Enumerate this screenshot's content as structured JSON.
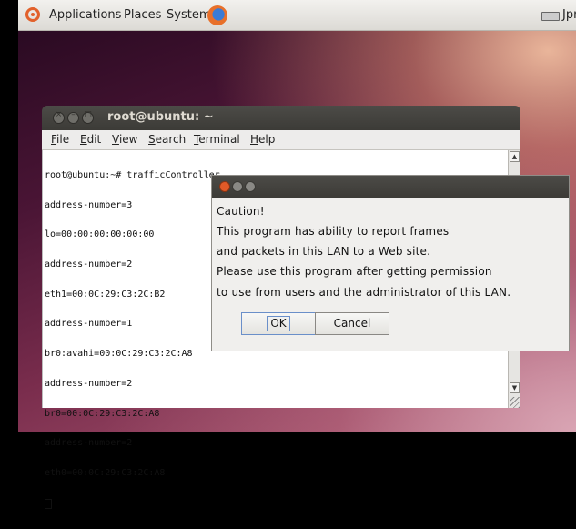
{
  "top_panel": {
    "menus": [
      "Applications",
      "Places",
      "System"
    ],
    "firefox_icon": "firefox-icon",
    "keyboard_icon": "keyboard-icon",
    "keyboard_layout": "Jpn"
  },
  "terminal": {
    "title": "root@ubuntu: ~",
    "menu": {
      "file": {
        "u": "F",
        "rest": "ile"
      },
      "edit": {
        "u": "E",
        "rest": "dit"
      },
      "view": {
        "u": "V",
        "rest": "iew"
      },
      "search": {
        "u": "S",
        "rest": "earch"
      },
      "terminal": {
        "u": "T",
        "rest": "erminal"
      },
      "help": {
        "u": "H",
        "rest": "elp"
      }
    },
    "lines": [
      "root@ubuntu:~# trafficController",
      "address-number=3",
      "lo=00:00:00:00:00:00",
      "address-number=2",
      "eth1=00:0C:29:C3:2C:B2",
      "address-number=1",
      "br0:avahi=00:0C:29:C3:2C:A8",
      "address-number=2",
      "br0=00:0C:29:C3:2C:A8",
      "address-number=2",
      "eth0=00:0C:29:C3:2C:A8"
    ]
  },
  "dialog": {
    "lines": [
      "Caution!",
      "This program has ability to report frames",
      "and packets in this LAN to a Web site.",
      "Please use this program after getting permission",
      "to use from users and the administrator of this LAN."
    ],
    "ok_label": "OK",
    "cancel_label": "Cancel"
  }
}
